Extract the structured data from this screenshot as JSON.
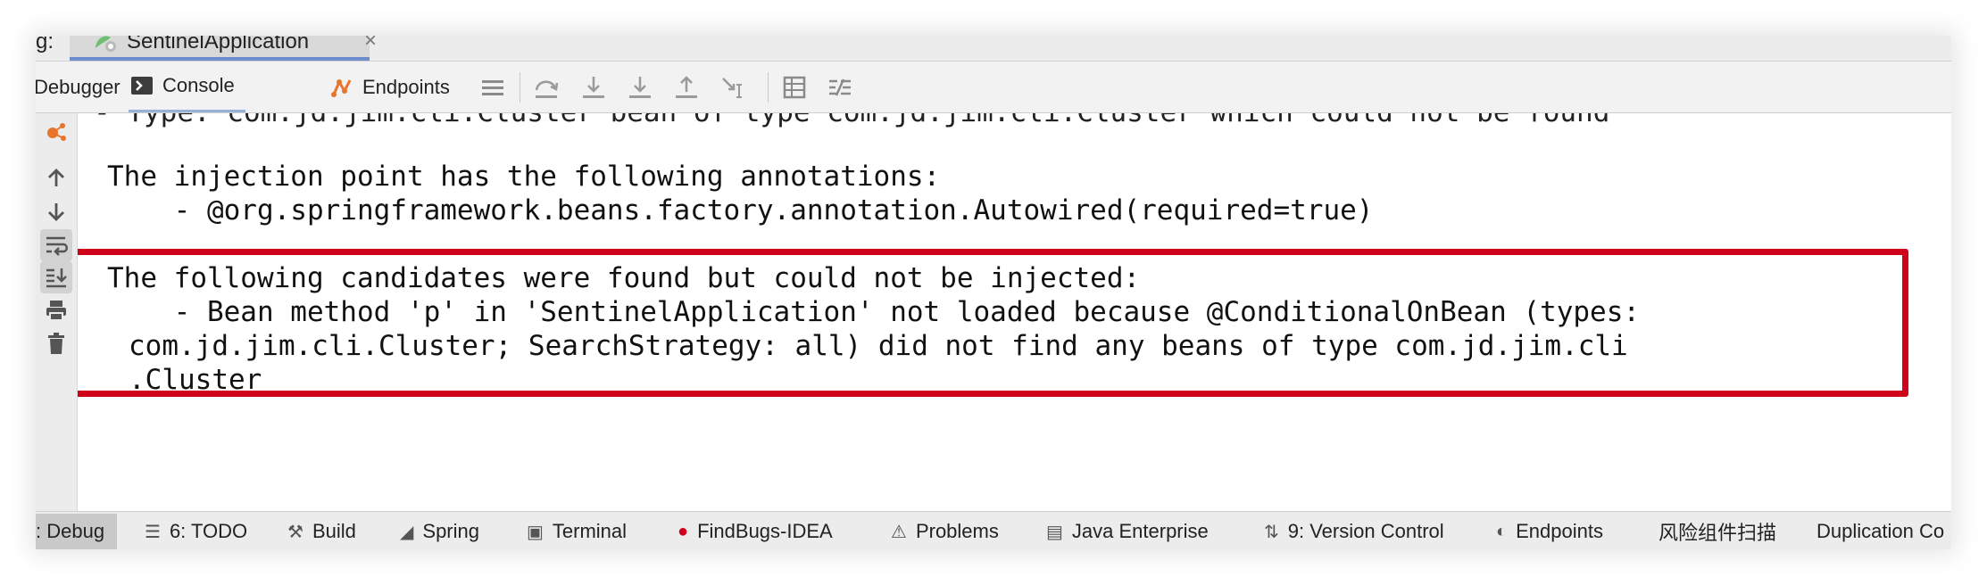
{
  "header": {
    "strip_prefix": "g:",
    "run_tab": {
      "label": "SentinelApplication",
      "close": "×"
    }
  },
  "toolbar": {
    "tabs": [
      {
        "label": "Debugger"
      },
      {
        "label": "Console"
      },
      {
        "label": "Endpoints"
      }
    ],
    "icons": [
      "menu-icon",
      "step-over-icon",
      "step-into-icon",
      "force-step-into-icon",
      "step-out-icon",
      "run-to-cursor-icon",
      "evaluate-table-icon",
      "trace-icon"
    ]
  },
  "gutter": {
    "icons": [
      "spring-bean-icon",
      "up-arrow-icon",
      "down-arrow-icon",
      "soft-wrap-icon",
      "scroll-to-end-icon",
      "print-icon",
      "trash-icon"
    ]
  },
  "console": {
    "lines": [
      {
        "text": "The injection point has the following annotations:"
      },
      {
        "text": "    - @org.springframework.beans.factory.annotation.Autowired(required=true)"
      },
      {
        "text": "The following candidates were found but could not be injected:"
      },
      {
        "text": "    - Bean method 'p' in 'SentinelApplication' not loaded because @ConditionalOnBean (types:"
      },
      {
        "text": "com.jd.jim.cli.Cluster; SearchStrategy: all) did not find any beans of type com.jd.jim.cli"
      },
      {
        "text": ".Cluster"
      }
    ],
    "highlight_color": "#d0021b"
  },
  "bottombar": {
    "items": [
      {
        "label": ": Debug",
        "glyph": ""
      },
      {
        "label": "6: TODO",
        "glyph": "☰"
      },
      {
        "label": "Build",
        "glyph": "⚒"
      },
      {
        "label": "Spring",
        "glyph": "◢"
      },
      {
        "label": "Terminal",
        "glyph": "▣"
      },
      {
        "label": "FindBugs-IDEA",
        "glyph": "●"
      },
      {
        "label": "Problems",
        "glyph": "⚠"
      },
      {
        "label": "Java Enterprise",
        "glyph": "▤"
      },
      {
        "label": "9: Version Control",
        "glyph": "⇅"
      },
      {
        "label": "Endpoints",
        "glyph": "◐"
      },
      {
        "label": "风险组件扫描",
        "glyph": ""
      },
      {
        "label": "Duplication Co",
        "glyph": ""
      }
    ]
  },
  "colors": {
    "accent_tab_underline": "#6f8ccf",
    "highlight_border": "#d0021b",
    "findbugs_red": "#d0021b"
  }
}
